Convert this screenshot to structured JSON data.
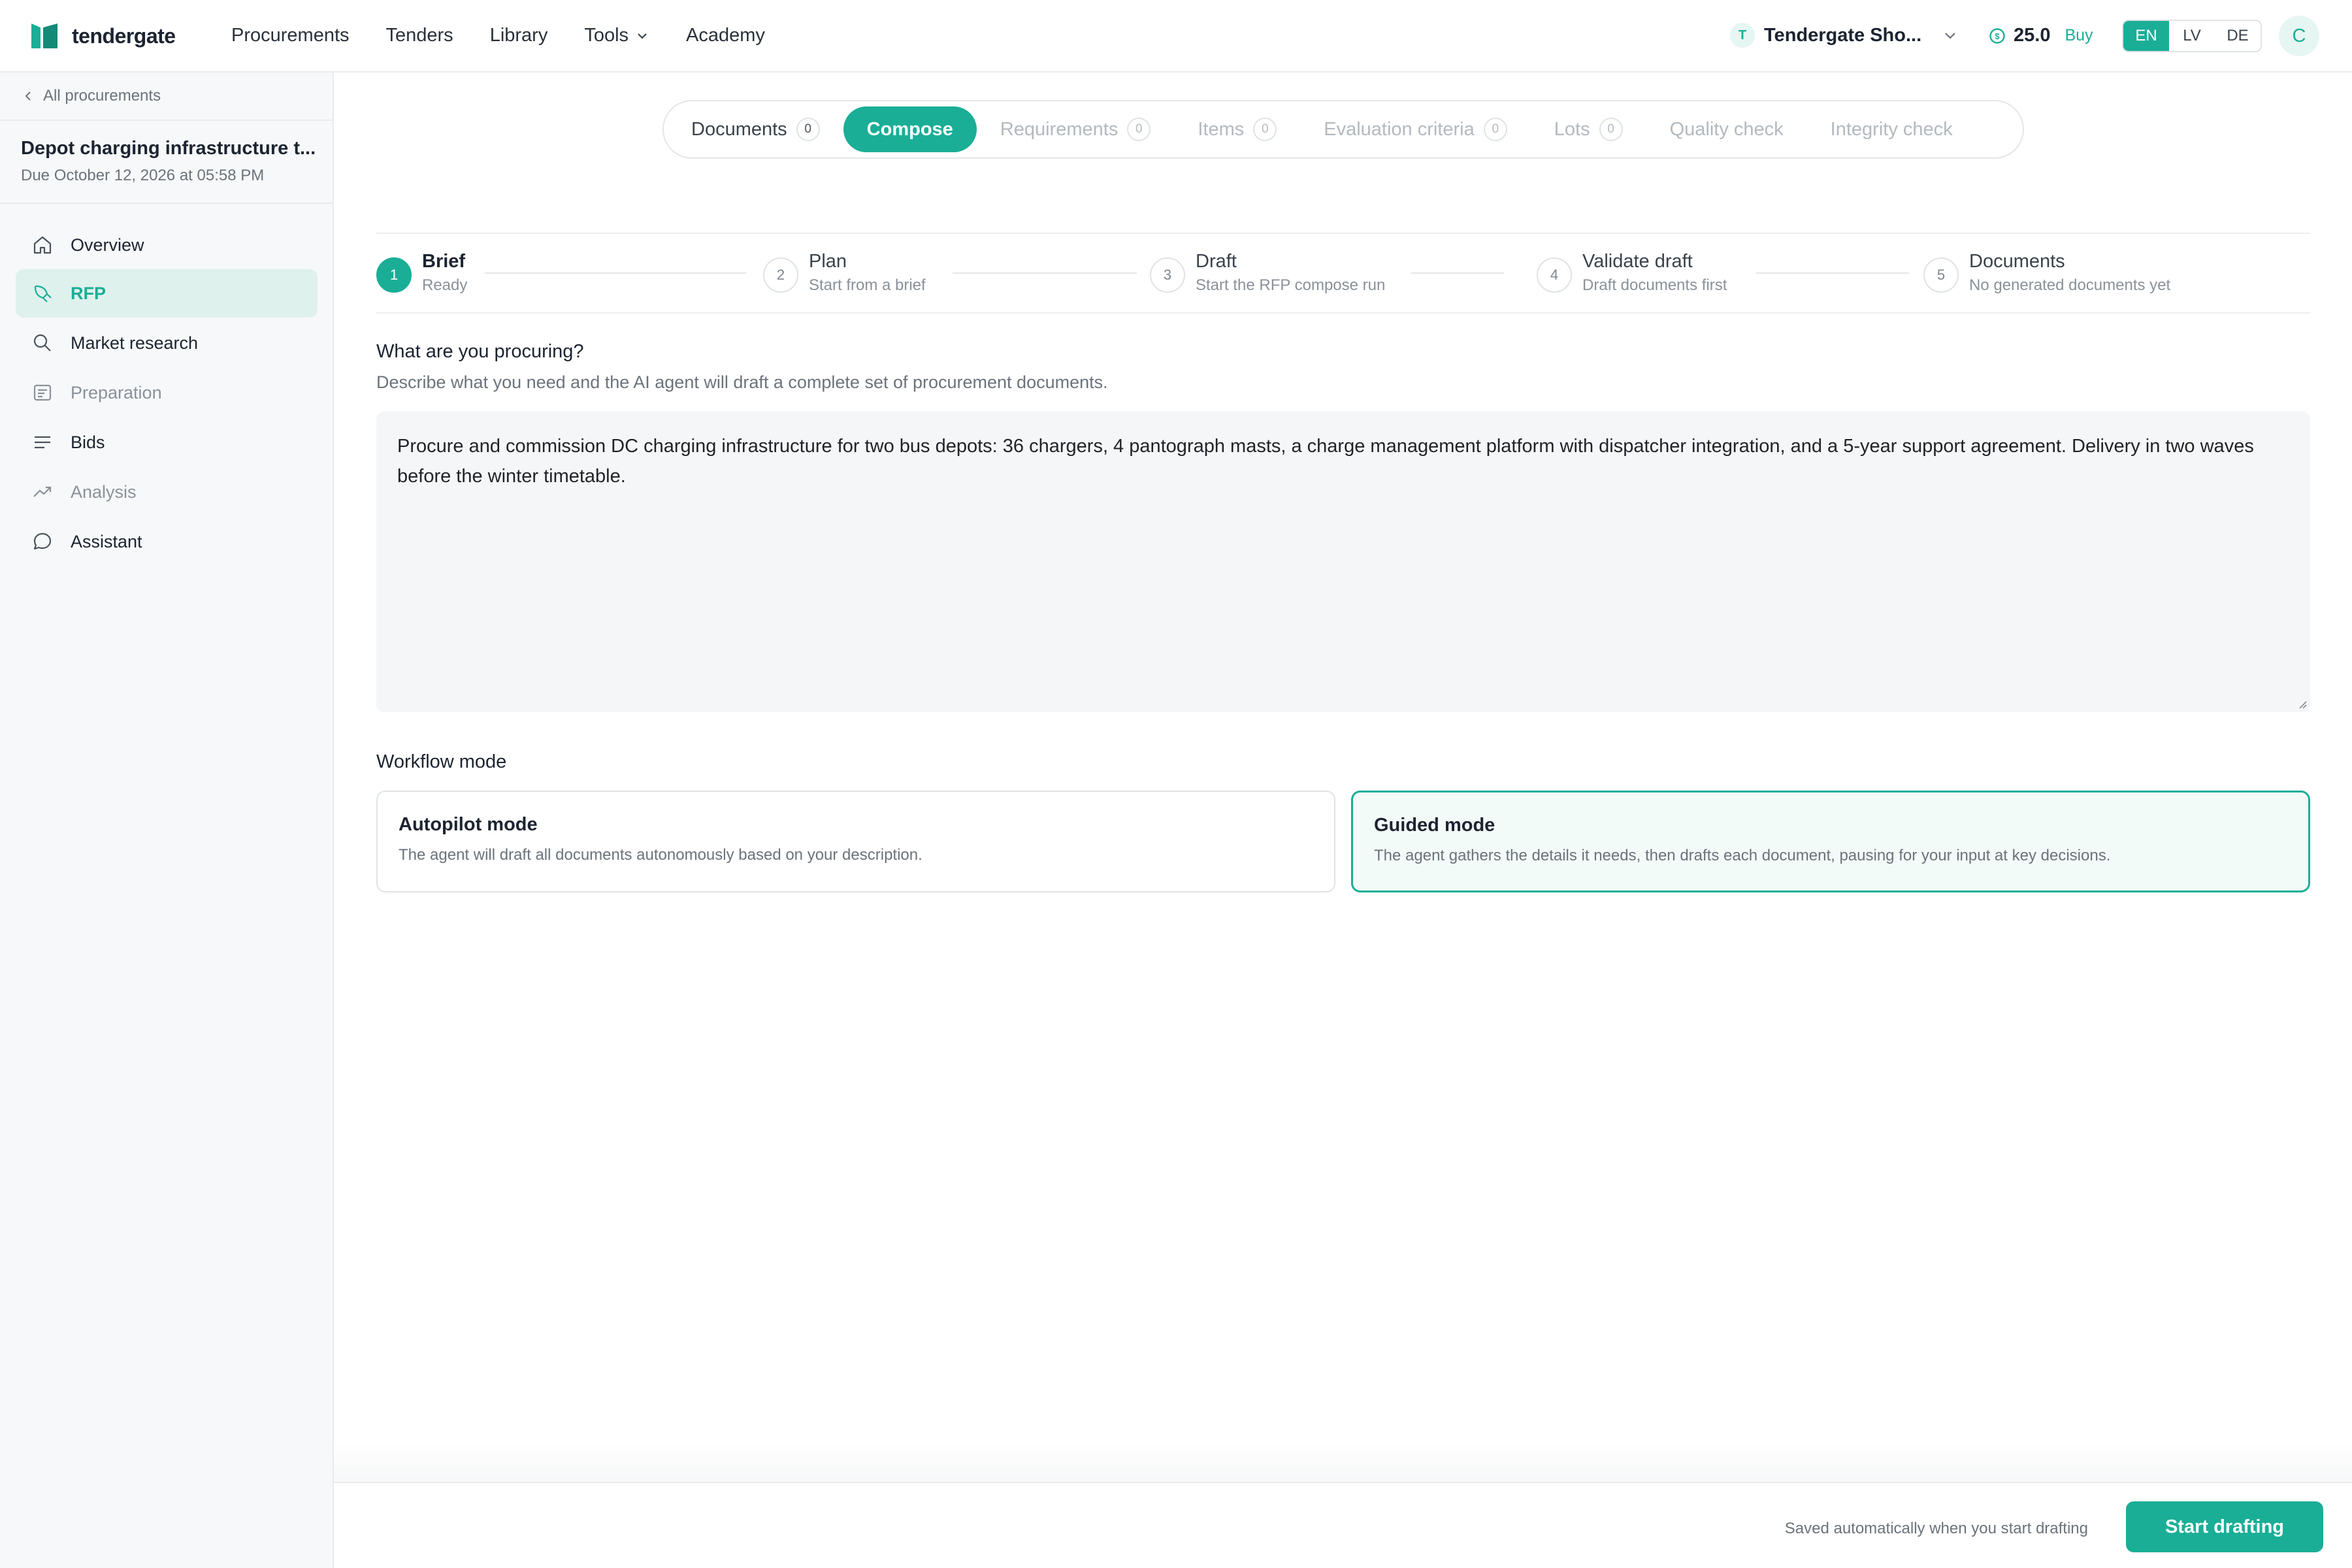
{
  "topbar": {
    "brand": "tendergate",
    "nav": [
      "Procurements",
      "Tenders",
      "Library",
      "Tools",
      "Academy"
    ],
    "org_initial": "T",
    "org_name": "Tendergate Sho...",
    "credits": "25.0",
    "buy_label": "Buy",
    "languages": [
      "EN",
      "LV",
      "DE"
    ],
    "active_language": "EN",
    "avatar_initial": "C"
  },
  "sidebar": {
    "back_label": "All procurements",
    "procurement_title": "Depot charging infrastructure t...",
    "due": "Due October 12, 2026 at 05:58 PM",
    "items": [
      {
        "label": "Overview",
        "icon": "home-icon"
      },
      {
        "label": "RFP",
        "icon": "pen-nib-icon"
      },
      {
        "label": "Market research",
        "icon": "search-icon"
      },
      {
        "label": "Preparation",
        "icon": "list-box-icon"
      },
      {
        "label": "Bids",
        "icon": "lines-icon"
      },
      {
        "label": "Analysis",
        "icon": "trend-icon"
      },
      {
        "label": "Assistant",
        "icon": "chat-icon"
      }
    ],
    "active_item": "RFP"
  },
  "tabs": [
    {
      "label": "Documents",
      "count": "0"
    },
    {
      "label": "Compose"
    },
    {
      "label": "Requirements",
      "count": "0"
    },
    {
      "label": "Items",
      "count": "0"
    },
    {
      "label": "Evaluation criteria",
      "count": "0"
    },
    {
      "label": "Lots",
      "count": "0"
    },
    {
      "label": "Quality check"
    },
    {
      "label": "Integrity check"
    }
  ],
  "steps": [
    {
      "num": "1",
      "title": "Brief",
      "sub": "Ready"
    },
    {
      "num": "2",
      "title": "Plan",
      "sub": "Start from a brief"
    },
    {
      "num": "3",
      "title": "Draft",
      "sub": "Start the RFP compose run"
    },
    {
      "num": "4",
      "title": "Validate draft",
      "sub": "Draft documents first"
    },
    {
      "num": "5",
      "title": "Documents",
      "sub": "No generated documents yet"
    }
  ],
  "brief": {
    "question": "What are you procuring?",
    "help": "Describe what you need and the AI agent will draft a complete set of procurement documents.",
    "text": "Procure and commission DC charging infrastructure for two bus depots: 36 chargers, 4 pantograph masts, a charge management platform with dispatcher integration, and a 5-year support agreement. Delivery in two waves before the winter timetable."
  },
  "workflow": {
    "label": "Workflow mode",
    "autopilot_title": "Autopilot mode",
    "autopilot_desc": "The agent will draft all documents autonomously based on your description.",
    "guided_title": "Guided mode",
    "guided_desc": "The agent gathers the details it needs, then drafts each document, pausing for your input at key decisions.",
    "selected": "Guided mode"
  },
  "footer": {
    "saved_note": "Saved automatically when you start drafting",
    "start_label": "Start drafting"
  },
  "colors": {
    "accent": "#1aae96",
    "accent_light": "#dff1ec"
  }
}
